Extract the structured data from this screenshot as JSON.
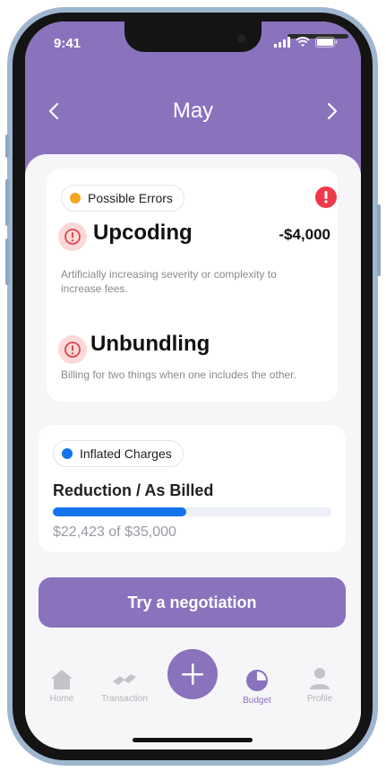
{
  "status": {
    "time": "9:41"
  },
  "header": {
    "month": "May"
  },
  "errors_card": {
    "badge": "Possible Errors",
    "items": [
      {
        "title": "Upcoding",
        "amount": "-$4,000",
        "description": "Artificially increasing severity or complexity to increase fees."
      },
      {
        "title": "Unbundling",
        "amount": "",
        "description": "Billing for two things when one includes the other."
      }
    ]
  },
  "charges_card": {
    "badge": "Inflated Charges",
    "title": "Reduction / As Billed",
    "progress": 0.48,
    "summary": "$22,423 of $35,000"
  },
  "cta": {
    "label": "Try a negotiation"
  },
  "tabbar": {
    "items": [
      {
        "label": "Home",
        "icon": "home-icon"
      },
      {
        "label": "Transaction",
        "icon": "transaction-icon"
      },
      {
        "label": "Budget",
        "icon": "pie-chart-icon"
      },
      {
        "label": "Profile",
        "icon": "user-icon"
      }
    ],
    "fab_icon": "plus-icon"
  },
  "colors": {
    "accent": "#8a72bd",
    "error_dot": "#f5a623",
    "alert_red": "#f0394a",
    "charges_dot": "#1374f0"
  }
}
